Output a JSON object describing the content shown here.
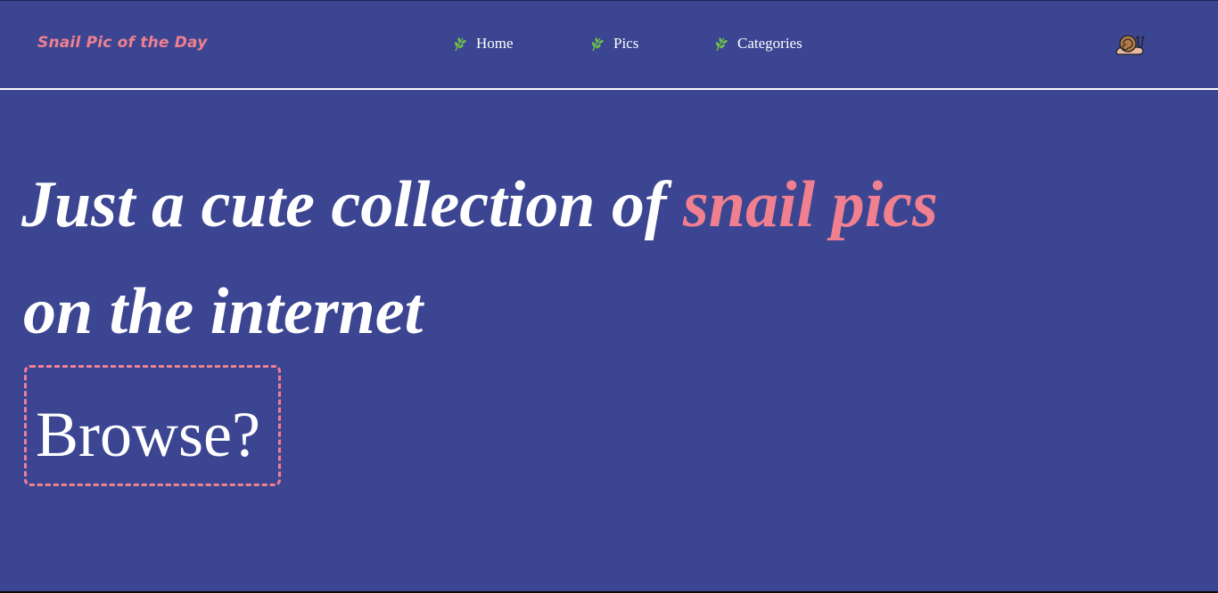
{
  "nav": {
    "brand": "Snail Pic of the Day",
    "links": [
      {
        "label": "Home",
        "icon": "leaf-icon"
      },
      {
        "label": "Pics",
        "icon": "leaf-icon"
      },
      {
        "label": "Categories",
        "icon": "leaf-icon"
      }
    ],
    "logo_icon": "snail-icon"
  },
  "hero": {
    "line1_prefix": "Just a cute collection of",
    "line1_highlight": "snail pics",
    "line2": "on the internet",
    "cta_label": "Browse?"
  },
  "colors": {
    "background": "#3b4591",
    "accent": "#f08090",
    "text": "#ffffff",
    "leaf": "#6cc04a"
  }
}
